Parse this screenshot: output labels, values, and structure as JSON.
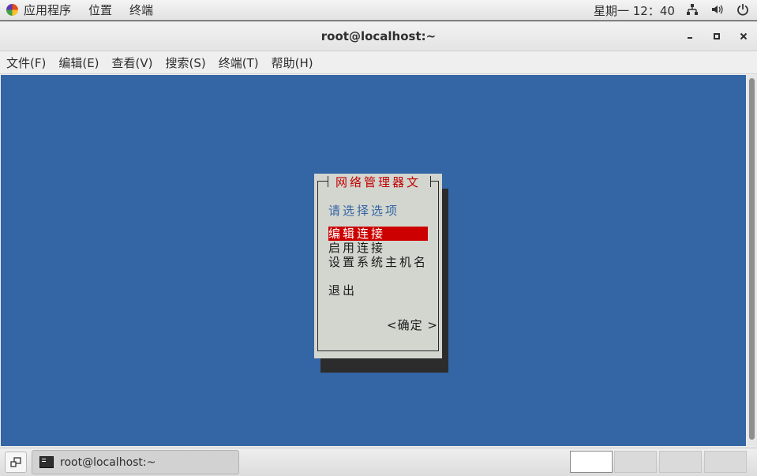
{
  "top_panel": {
    "applications": "应用程序",
    "places": "位置",
    "terminal": "终端",
    "clock": "星期一 12：40",
    "tray_icons": [
      "network-icon",
      "volume-icon",
      "power-icon"
    ]
  },
  "window": {
    "title": "root@localhost:~",
    "buttons": [
      "minimize",
      "maximize",
      "close"
    ],
    "menu": [
      "文件(F)",
      "编辑(E)",
      "查看(V)",
      "搜索(S)",
      "终端(T)",
      "帮助(H)"
    ]
  },
  "dialog": {
    "title": "网络管理器文",
    "prompt": "请选择选项",
    "items": [
      "编辑连接",
      "启用连接",
      "设置系统主机名",
      "退出"
    ],
    "selected_index": 0,
    "ok_button": "<确定 >"
  },
  "taskbar": {
    "task_label": "root@localhost:~",
    "workspaces": 4,
    "active_workspace": 1
  },
  "colors": {
    "terminal_bg": "#3465a4",
    "dialog_bg": "#d3d6cf",
    "dialog_title": "#c00000",
    "selection": "#cc0000"
  }
}
